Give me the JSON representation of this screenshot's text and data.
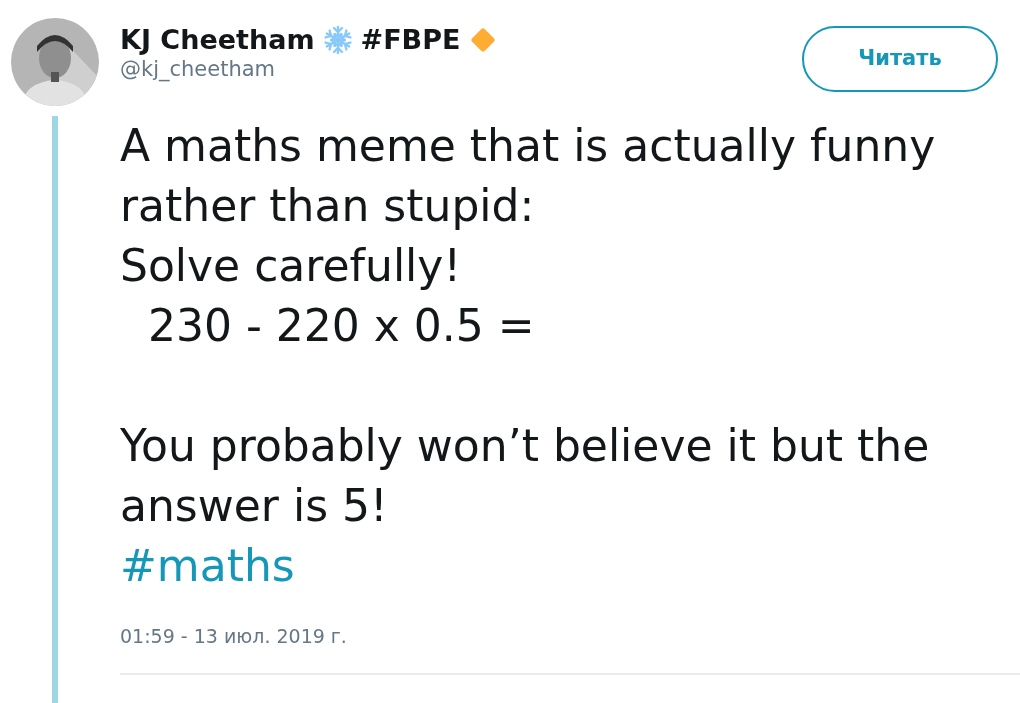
{
  "author": {
    "name": "KJ Cheetham",
    "tag": "#FBPE",
    "handle": "@kj_cheetham"
  },
  "follow_button": {
    "label": "Читать"
  },
  "tweet": {
    "lines": [
      {
        "kind": "line",
        "text": "A maths meme that is actually funny"
      },
      {
        "kind": "line",
        "text": "rather than stupid:"
      },
      {
        "kind": "line",
        "text": "Solve carefully!"
      },
      {
        "kind": "line",
        "text": "  230 - 220 x 0.5 ="
      },
      {
        "kind": "blank"
      },
      {
        "kind": "line",
        "text": "You probably won’t believe it but the"
      },
      {
        "kind": "line",
        "text": "answer is 5!"
      },
      {
        "kind": "hashtag",
        "text": "#maths"
      }
    ]
  },
  "timestamp": "01:59 - 13 июл. 2019 г."
}
